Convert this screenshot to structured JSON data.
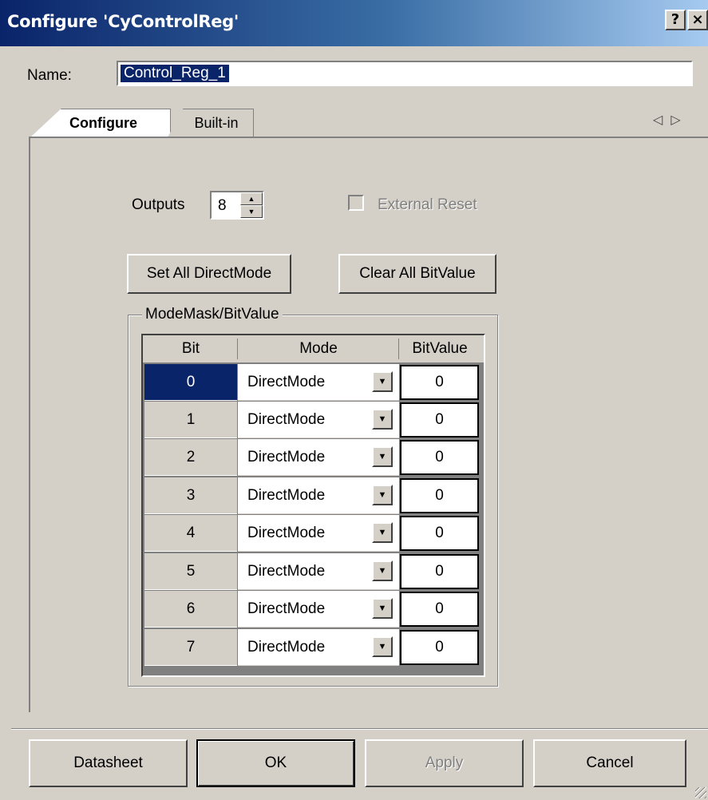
{
  "window": {
    "title": "Configure 'CyControlReg'",
    "help_label": "?",
    "close_label": "×"
  },
  "name": {
    "label": "Name:",
    "value": "Control_Reg_1"
  },
  "tabs": [
    {
      "label": "Configure",
      "active": true
    },
    {
      "label": "Built-in",
      "active": false
    }
  ],
  "tab_scroll": {
    "left": "◁",
    "right": "▷"
  },
  "configure": {
    "outputs_label": "Outputs",
    "outputs_value": "8",
    "external_reset_label": "External Reset",
    "external_reset_checked": false,
    "set_all_label": "Set All DirectMode",
    "clear_all_label": "Clear All BitValue",
    "group_title": "ModeMask/BitValue",
    "columns": [
      "Bit",
      "Mode",
      "BitValue"
    ],
    "rows": [
      {
        "bit": "0",
        "mode": "DirectMode",
        "value": "0",
        "selected": true
      },
      {
        "bit": "1",
        "mode": "DirectMode",
        "value": "0"
      },
      {
        "bit": "2",
        "mode": "DirectMode",
        "value": "0"
      },
      {
        "bit": "3",
        "mode": "DirectMode",
        "value": "0"
      },
      {
        "bit": "4",
        "mode": "DirectMode",
        "value": "0"
      },
      {
        "bit": "5",
        "mode": "DirectMode",
        "value": "0"
      },
      {
        "bit": "6",
        "mode": "DirectMode",
        "value": "0"
      },
      {
        "bit": "7",
        "mode": "DirectMode",
        "value": "0"
      }
    ]
  },
  "buttons": {
    "datasheet": "Datasheet",
    "ok": "OK",
    "apply": "Apply",
    "cancel": "Cancel",
    "apply_enabled": false
  },
  "colors": {
    "title_start": "#0a246a",
    "title_end": "#a6caf0",
    "face": "#d4d0c8",
    "selection": "#0a246a"
  }
}
